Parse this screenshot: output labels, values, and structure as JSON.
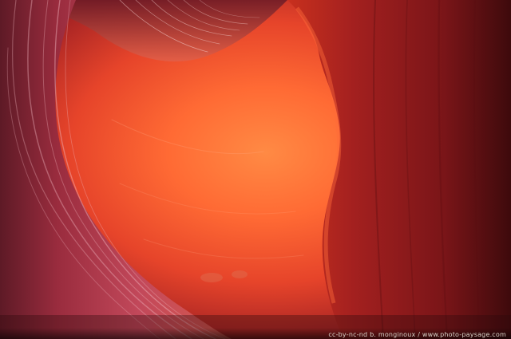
{
  "photo": {
    "subject": "slot canyon sandstone walls",
    "colors": {
      "glow_core": "#ff7a3a",
      "glow_mid": "#f04a28",
      "wall_left": "#b0384a",
      "wall_left_dark": "#5e1a26",
      "wall_right": "#a3201f",
      "wall_right_dark": "#3e0a0c",
      "highlight_pink": "#f1b7c0",
      "credit_text": "#d9d2c8"
    }
  },
  "credit": {
    "text": "cc-by-nc-nd    b. monginoux / www.photo-paysage.com"
  }
}
